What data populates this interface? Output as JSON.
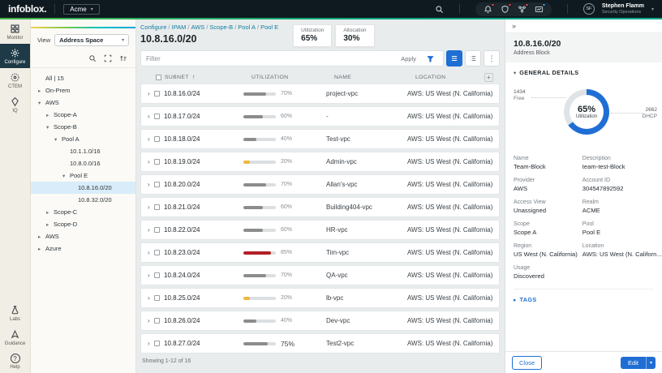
{
  "icons": {
    "tri_down": "▾",
    "tri_right": "▸",
    "chev_right": "›",
    "collapse": "»",
    "kebab": "⋮",
    "sort_up": "↑",
    "plus": "+",
    "caret": "▾",
    "help": "?"
  },
  "brand": {
    "logo": "infoblox.",
    "org": "Acme"
  },
  "topbar": {
    "user_initials": "SF",
    "user_name": "Stephen Flamm",
    "user_role": "Security Operations"
  },
  "rail": {
    "items": [
      {
        "label": "Monitor"
      },
      {
        "label": "Configure"
      },
      {
        "label": "CTEM"
      },
      {
        "label": "IQ"
      }
    ],
    "bottom": [
      {
        "label": "Labs"
      },
      {
        "label": "Guidance"
      },
      {
        "label": "Help"
      }
    ]
  },
  "tree": {
    "view_label": "View",
    "view_value": "Address Space",
    "items": [
      {
        "label": "All | 15"
      },
      {
        "label": "On-Prem"
      },
      {
        "label": "AWS"
      },
      {
        "label": "Scope-A"
      },
      {
        "label": "Scope-B"
      },
      {
        "label": "Pool A"
      },
      {
        "label": "10.1.1.0/16"
      },
      {
        "label": "10.8.0.0/16"
      },
      {
        "label": "Pool E"
      },
      {
        "label": "10.8.16.0/20"
      },
      {
        "label": "10.8.32.0/20"
      },
      {
        "label": "Scope-C"
      },
      {
        "label": "Scope-D"
      },
      {
        "label": "AWS"
      },
      {
        "label": "Azure"
      }
    ]
  },
  "breadcrumb": {
    "separator": "/",
    "items": [
      "Configure",
      "IPAM",
      "AWS",
      "Scope-B",
      "Pool A",
      "Pool E"
    ]
  },
  "page": {
    "title": "10.8.16.0/20",
    "stats": [
      {
        "label": "Utilization",
        "value": "65%"
      },
      {
        "label": "Allocation",
        "value": "30%"
      }
    ]
  },
  "filter": {
    "placeholder": "Filter",
    "apply": "Apply"
  },
  "table": {
    "columns": [
      "SUBNET",
      "UTILIZATION",
      "NAME",
      "LOCATION"
    ],
    "rows": [
      {
        "subnet": "10.8.16.0/24",
        "utilization": 70,
        "pct_text": "70%",
        "bar_color": "#8c8c8c",
        "name": "project-vpc",
        "location": "AWS: US West (N. California)"
      },
      {
        "subnet": "10.8.17.0/24",
        "utilization": 60,
        "pct_text": "60%",
        "bar_color": "#8c8c8c",
        "name": "-",
        "location": "AWS: US West (N. California)"
      },
      {
        "subnet": "10.8.18.0/24",
        "utilization": 40,
        "pct_text": "40%",
        "bar_color": "#8c8c8c",
        "name": "Test-vpc",
        "location": "AWS: US West (N. California)"
      },
      {
        "subnet": "10.8.19.0/24",
        "utilization": 20,
        "pct_text": "20%",
        "bar_color": "#edb73e",
        "name": "Admin-vpc",
        "location": "AWS: US West (N. California)"
      },
      {
        "subnet": "10.8.20.0/24",
        "utilization": 70,
        "pct_text": "70%",
        "bar_color": "#8c8c8c",
        "name": "Allan's-vpc",
        "location": "AWS: US West (N. California)"
      },
      {
        "subnet": "10.8.21.0/24",
        "utilization": 60,
        "pct_text": "60%",
        "bar_color": "#8c8c8c",
        "name": "Building404-vpc",
        "location": "AWS: US West (N. California)"
      },
      {
        "subnet": "10.8.22.0/24",
        "utilization": 60,
        "pct_text": "60%",
        "bar_color": "#8c8c8c",
        "name": "HR-vpc",
        "location": "AWS: US West (N. California)"
      },
      {
        "subnet": "10.8.23.0/24",
        "utilization": 85,
        "pct_text": "85%",
        "bar_color": "#b21f24",
        "name": "Tim-vpc",
        "location": "AWS: US West (N. California)"
      },
      {
        "subnet": "10.8.24.0/24",
        "utilization": 70,
        "pct_text": "70%",
        "bar_color": "#8c8c8c",
        "name": "QA-vpc",
        "location": "AWS: US West (N. California)"
      },
      {
        "subnet": "10.8.25.0/24",
        "utilization": 20,
        "pct_text": "20%",
        "bar_color": "#edb73e",
        "name": "lb-vpc",
        "location": "AWS: US West (N. California)"
      },
      {
        "subnet": "10.8.26.0/24",
        "utilization": 40,
        "pct_text": "40%",
        "bar_color": "#8c8c8c",
        "name": "Dev-vpc",
        "location": "AWS: US West (N. California)"
      },
      {
        "subnet": "10.8.27.0/24",
        "utilization": 75,
        "pct_text": "75%",
        "bar_color": "#8c8c8c",
        "name": "Test2-vpc",
        "location": "AWS: US West (N. California)"
      }
    ],
    "footer": "Showing 1-12 of 16"
  },
  "detail": {
    "title": "10.8.16.0/20",
    "subtitle": "Address Block",
    "section": "GENERAL DETAILS",
    "donut": {
      "percent": 65,
      "value_text": "65%",
      "label": "Utilization",
      "color": "#1f6ed4",
      "track": "#dfe3e6",
      "callout_left_value": "1434",
      "callout_left_label": "Free",
      "callout_right_value": "2662",
      "callout_right_label": "DHCP"
    },
    "fields": [
      {
        "label": "Name",
        "value": "Team-Block"
      },
      {
        "label": "Description",
        "value": "team-test-Block"
      },
      {
        "label": "Provider",
        "value": "AWS"
      },
      {
        "label": "Account ID",
        "value": "304547892592"
      },
      {
        "label": "Access View",
        "value": "Unassigned"
      },
      {
        "label": "Realm",
        "value": "ACME"
      },
      {
        "label": "Scope",
        "value": "Scope A"
      },
      {
        "label": "Pool",
        "value": "Pool E"
      },
      {
        "label": "Region",
        "value": "US West (N. California)"
      },
      {
        "label": "Location",
        "value": "AWS: US West (N. Californ..."
      },
      {
        "label": "Usage",
        "value": "Discovered"
      }
    ],
    "tags_label": "TAGS",
    "close_label": "Close",
    "edit_label": "Edit"
  }
}
